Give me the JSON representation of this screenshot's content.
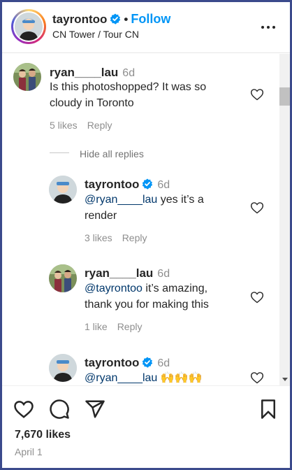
{
  "post": {
    "author": "tayrontoo",
    "separator": "•",
    "follow_label": "Follow",
    "location": "CN Tower / Tour CN",
    "likes": "7,670 likes",
    "date": "April 1"
  },
  "comments": [
    {
      "user": "ryan____lau",
      "time": "6d",
      "text": "Is this photoshopped? It was so cloudy in Toronto",
      "likes": "5 likes",
      "reply_label": "Reply"
    }
  ],
  "hide_replies_label": "Hide all replies",
  "replies": [
    {
      "user": "tayrontoo",
      "verified": true,
      "time": "6d",
      "mention": "@ryan____lau",
      "text": " yes it’s a render",
      "likes": "3 likes",
      "reply_label": "Reply"
    },
    {
      "user": "ryan____lau",
      "time": "6d",
      "mention": "@tayrontoo",
      "text": " it’s amazing, thank you for making this",
      "likes": "1 like",
      "reply_label": "Reply"
    },
    {
      "user": "tayrontoo",
      "verified": true,
      "time": "6d",
      "mention": "@ryan____lau",
      "text": " 🙌🙌🙌"
    }
  ],
  "icons": {
    "verified": "verified-badge-icon",
    "more": "more-horizontal-icon",
    "like": "heart-icon",
    "comment": "comment-icon",
    "share": "share-icon",
    "save": "bookmark-icon"
  },
  "colors": {
    "accent": "#0095f6",
    "verified": "#0095f6",
    "mention": "#00376b",
    "frame": "#3b4a8c"
  }
}
